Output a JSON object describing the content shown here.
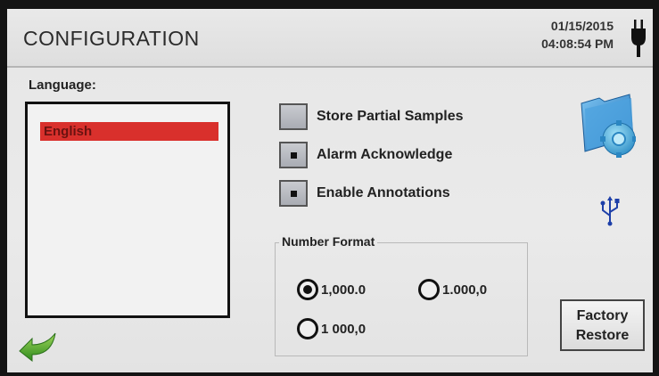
{
  "header": {
    "title": "CONFIGURATION",
    "date": "01/15/2015",
    "time": "04:08:54 PM",
    "power_icon": "plug-icon"
  },
  "language": {
    "label": "Language:",
    "items": [
      "English"
    ],
    "selected": "English",
    "selected_color": "#d9302c"
  },
  "options": [
    {
      "label": "Store Partial Samples",
      "checked": false
    },
    {
      "label": "Alarm Acknowledge",
      "checked": true
    },
    {
      "label": "Enable Annotations",
      "checked": true
    }
  ],
  "number_format": {
    "legend": "Number Format",
    "choices": [
      "1,000.0",
      "1.000,0",
      "1 000,0"
    ],
    "selected": "1,000.0"
  },
  "icons": {
    "settings": "folder-gear-icon",
    "usb": "usb-icon",
    "back": "back-arrow-icon"
  },
  "factory_restore": {
    "line1": "Factory",
    "line2": "Restore"
  }
}
